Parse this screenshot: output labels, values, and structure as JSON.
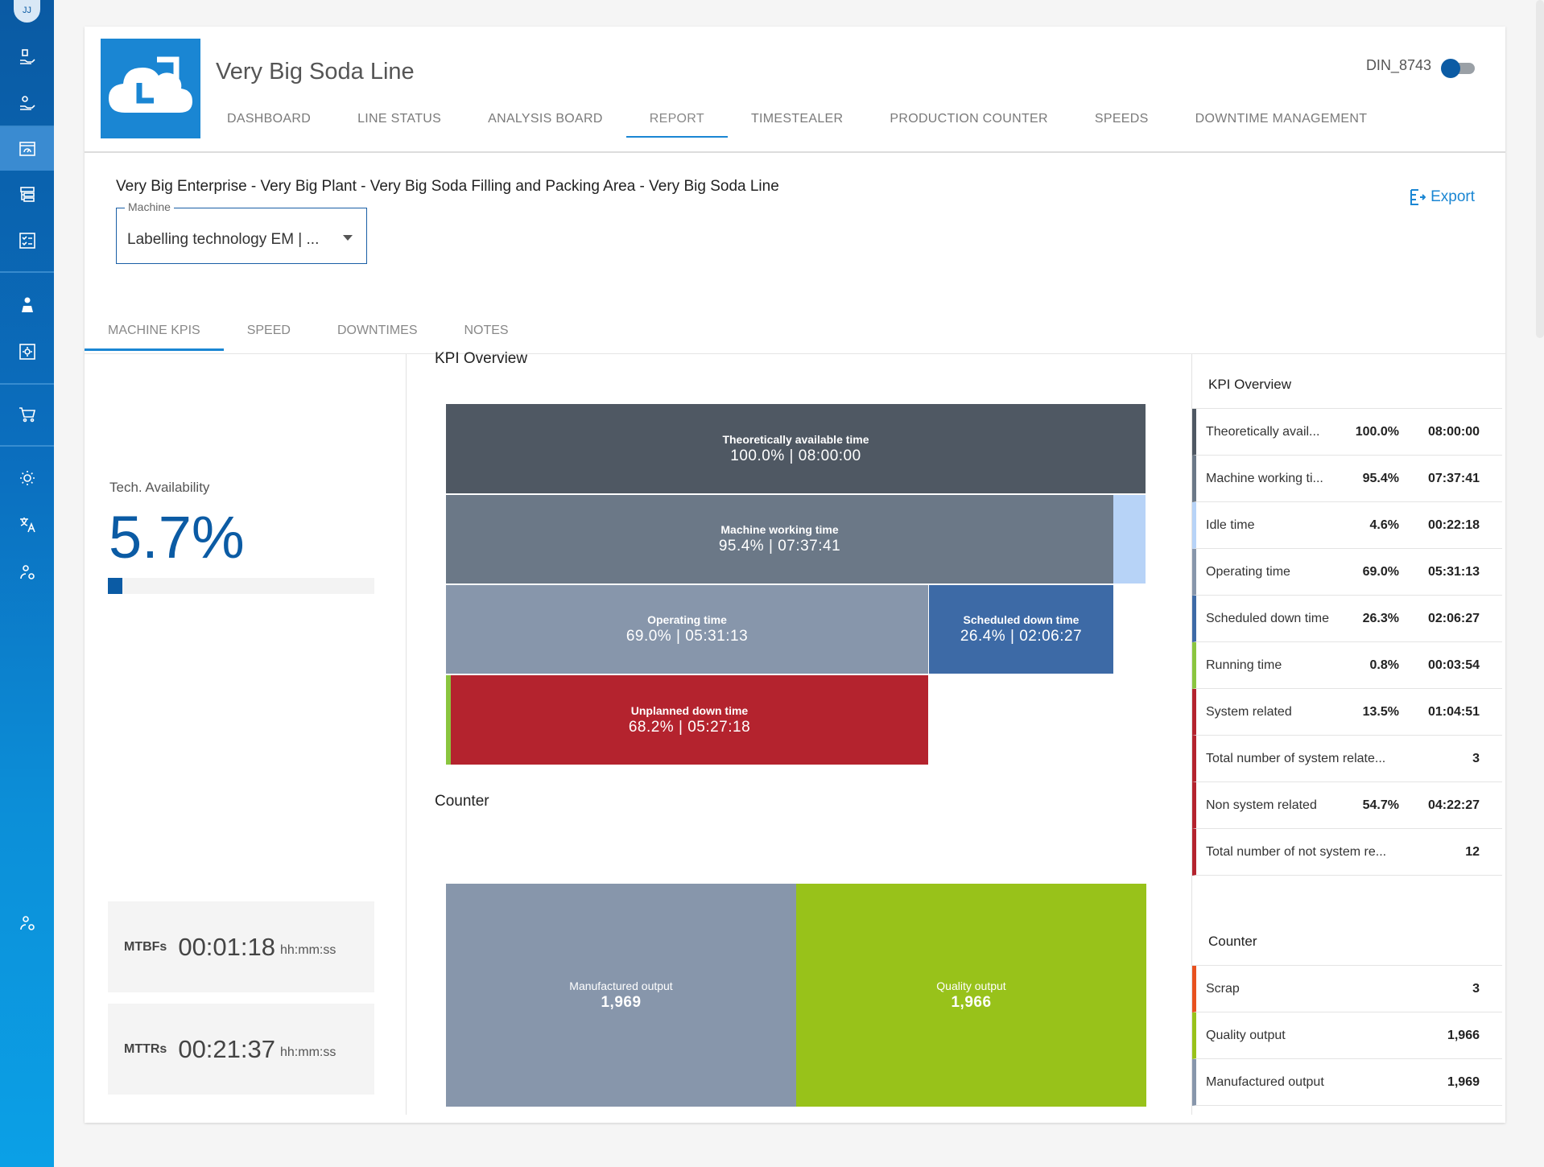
{
  "user": {
    "initials": "JJ",
    "id": "DIN_8743"
  },
  "app": {
    "title": "Very Big Soda Line"
  },
  "nav": [
    "DASHBOARD",
    "LINE STATUS",
    "ANALYSIS BOARD",
    "REPORT",
    "TIMESTEALER",
    "PRODUCTION COUNTER",
    "SPEEDS",
    "DOWNTIME MANAGEMENT"
  ],
  "nav_active": "REPORT",
  "breadcrumb": "Very Big Enterprise - Very Big Plant - Very Big Soda Filling and Packing Area - Very Big Soda Line",
  "export_label": "Export",
  "machine": {
    "label": "Machine",
    "value": "Labelling technology EM | ..."
  },
  "subtabs": [
    "MACHINE KPIS",
    "SPEED",
    "DOWNTIMES",
    "NOTES"
  ],
  "left": {
    "tech_label": "Tech. Availability",
    "tech_value": "5.7%",
    "tech_fraction": 0.057,
    "mtbf": {
      "key": "MTBFs",
      "value": "00:01:18",
      "unit": "hh:mm:ss"
    },
    "mttr": {
      "key": "MTTRs",
      "value": "00:21:37",
      "unit": "hh:mm:ss"
    }
  },
  "middle": {
    "kpi_title": "KPI Overview",
    "counter_title": "Counter",
    "blocks": {
      "theoretical": {
        "label": "Theoretically available time",
        "value": "100.0% | 08:00:00"
      },
      "working": {
        "label": "Machine working time",
        "value": "95.4% | 07:37:41"
      },
      "operating": {
        "label": "Operating time",
        "value": "69.0% | 05:31:13"
      },
      "scheduled": {
        "label": "Scheduled down time",
        "value": "26.4% | 02:06:27"
      },
      "unplanned": {
        "label": "Unplanned down time",
        "value": "68.2% | 05:27:18"
      },
      "manufactured": {
        "label": "Manufactured output",
        "value": "1,969"
      },
      "quality": {
        "label": "Quality output",
        "value": "1,966"
      }
    }
  },
  "right": {
    "kpi_title": "KPI Overview",
    "kpi_rows": [
      {
        "name": "Theoretically avail...",
        "pct": "100.0%",
        "time": "08:00:00",
        "color": "#4f5863"
      },
      {
        "name": "Machine working ti...",
        "pct": "95.4%",
        "time": "07:37:41",
        "color": "#6b7887"
      },
      {
        "name": "Idle time",
        "pct": "4.6%",
        "time": "00:22:18",
        "color": "#b7d3f7"
      },
      {
        "name": "Operating time",
        "pct": "69.0%",
        "time": "05:31:13",
        "color": "#8796ab"
      },
      {
        "name": "Scheduled down time",
        "pct": "26.3%",
        "time": "02:06:27",
        "color": "#3d6aa6"
      },
      {
        "name": "Running time",
        "pct": "0.8%",
        "time": "00:03:54",
        "color": "#8ac53f"
      },
      {
        "name": "System related",
        "pct": "13.5%",
        "time": "01:04:51",
        "color": "#b4232e"
      },
      {
        "name": "Total number of system relate...",
        "count": "3",
        "color": "#b4232e"
      },
      {
        "name": "Non system related",
        "pct": "54.7%",
        "time": "04:22:27",
        "color": "#b4232e"
      },
      {
        "name": "Total number of not system re...",
        "count": "12",
        "color": "#b4232e"
      }
    ],
    "counter_title": "Counter",
    "counter_rows": [
      {
        "name": "Scrap",
        "count": "3",
        "color": "#e8511f"
      },
      {
        "name": "Quality output",
        "count": "1,966",
        "color": "#98c21a"
      },
      {
        "name": "Manufactured output",
        "count": "1,969",
        "color": "#8796ab"
      }
    ]
  }
}
